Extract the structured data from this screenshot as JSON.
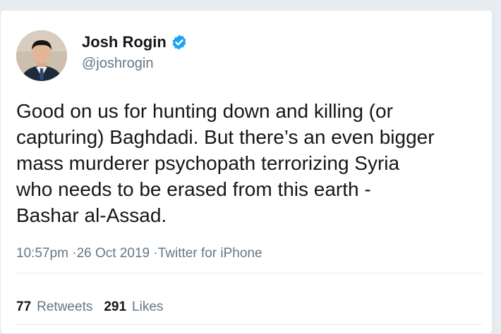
{
  "tweet": {
    "display_name": "Josh Rogin",
    "handle": "@joshrogin",
    "verified_color": "#1da1f2",
    "text": "Good on us for hunting down and killing (or\ncapturing) Baghdadi. But there’s an even bigger\nmass murderer psychopath terrorizing Syria\nwho needs to be erased from this earth -\nBashar al-Assad.",
    "time": "10:57pm",
    "date": "26 Oct 2019",
    "source": "Twitter for iPhone",
    "retweets_count": "77",
    "retweets_label": "Retweets",
    "likes_count": "291",
    "likes_label": "Likes"
  },
  "icons": {
    "verified": "verified-badge-icon",
    "avatar": "profile-avatar"
  }
}
